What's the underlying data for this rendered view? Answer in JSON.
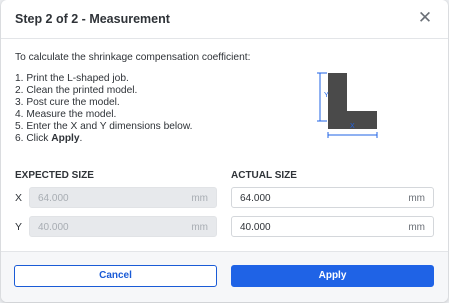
{
  "dialog": {
    "title": "Step 2 of 2 - Measurement",
    "close_glyph": "✕",
    "intro": "To calculate the shrinkage compensation coefficient:",
    "steps": [
      "1. Print the L-shaped job.",
      "2. Clean the printed model.",
      "3. Post cure the model.",
      "4. Measure the model.",
      "5. Enter the X and Y dimensions below."
    ],
    "step6_prefix": "6. Click ",
    "step6_bold": "Apply",
    "step6_suffix": ".",
    "diagram": {
      "y_label": "Y",
      "x_label": "X",
      "accent": "#1f63e6",
      "shape_color": "#4a4a4a"
    }
  },
  "form": {
    "expected_header": "EXPECTED SIZE",
    "actual_header": "ACTUAL SIZE",
    "rows": [
      {
        "label": "X",
        "expected": "64.000",
        "actual": "64.000",
        "unit": "mm"
      },
      {
        "label": "Y",
        "expected": "40.000",
        "actual": "40.000",
        "unit": "mm"
      }
    ]
  },
  "footer": {
    "cancel_label": "Cancel",
    "apply_label": "Apply"
  },
  "colors": {
    "primary": "#1f63e6",
    "text": "#2f3338",
    "disabled_bg": "#e7e9ec"
  }
}
